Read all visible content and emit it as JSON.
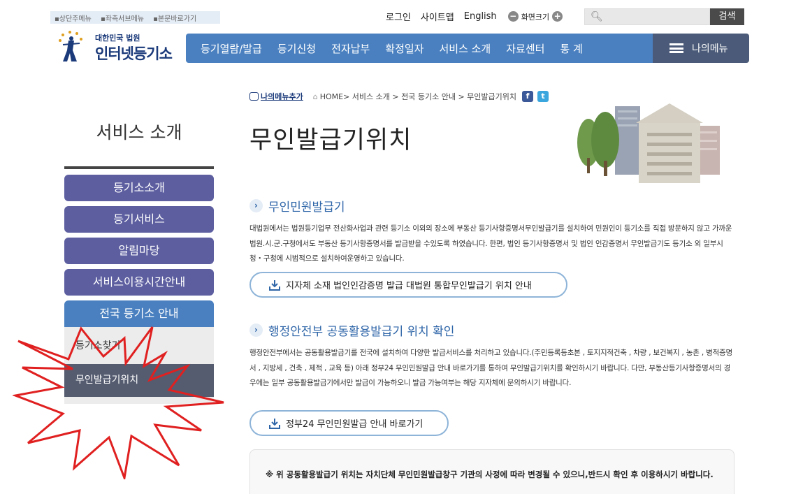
{
  "skip_links": [
    "상단주메뉴",
    "좌측서브메뉴",
    "본문바로가기"
  ],
  "util": {
    "login": "로그인",
    "sitemap": "사이트맵",
    "english": "English",
    "zoom_minus": "−",
    "zoom_label": "화면크기",
    "zoom_plus": "+",
    "search_placeholder": "",
    "search_button": "검색"
  },
  "logo": {
    "top": "대한민국 법원",
    "name": "인터넷등기소"
  },
  "gnb": [
    "등기열람/발급",
    "등기신청",
    "전자납부",
    "확정일자",
    "서비스 소개",
    "자료센터",
    "통 계"
  ],
  "my_menu": "나의메뉴",
  "lnb": {
    "title": "서비스 소개",
    "items": [
      "등기소소개",
      "등기서비스",
      "알림마당",
      "서비스이용시간안내"
    ],
    "active": "전국 등기소 안내",
    "sub_items": [
      "등기소찾기",
      "무인발급기위치"
    ]
  },
  "breadcrumb": {
    "add_menu": "나의메뉴추가",
    "path": "HOME> 서비스 소개 > 전국 등기소 안내 > 무인발급기위치",
    "facebook": "f",
    "twitter": "t"
  },
  "page_title": "무인발급기위치",
  "section1": {
    "title": "무인민원발급기",
    "body": "대법원에서는 법원등기업무 전산화사업과 관련 등기소 이외의 장소에 부동산 등기사항증명서무인발급기를 설치하여 민원인이 등기소를 직접 방문하지 않고 가까운 법원.시.군.구청에서도 부동산 등기사항증명서를 발급받을 수있도록 하였습니다. 한편, 법인 등기사항증명서 및 법인 인감증명서 무인발급기도 등기소 외 일부시청・구청에 시범적으로 설치하여운영하고 있습니다.",
    "button": "지자체 소재 법인인감증명 발급 대법원 통합무인발급기 위치 안내"
  },
  "section2": {
    "title": "행정안전부 공동활용발급기 위치 확인",
    "body": "행정안전부에서는 공동활용발급기를 전국에 설치하여 다양한 발급서비스를 처리하고 있습니다.(주민등록등초본 , 토지지적건축 , 차량 , 보건복지 , 농촌 , 병적증명서 , 지방세 , 건축 , 제적 , 교육 등) 아래 정부24 무인민원발급 안내 바로가기를 통하여 무인발급기위치를 확인하시기 바랍니다. 다만, 부동산등기사항증명서의 경우에는 일부 공동활용발급기에서만 발급이 가능하오니 발급 가능여부는 해당 지자체에 문의하시기 바랍니다.",
    "button": "정부24 무인민원발급 안내 바로가기"
  },
  "notice": "※ 위 공동활용발급기 위치는 자치단체 무인민원발급창구 기관의 사정에 따라 변경될 수 있으니,반드시 확인 후 이용하시기 바랍니다.",
  "colors": {
    "gnb": "#4a80c0",
    "my_menu": "#4a5a78",
    "lnb_item": "#5c5ea0",
    "lnb_active_sub": "#555c70",
    "section_title": "#2f66a8",
    "starburst": "#e02020"
  }
}
